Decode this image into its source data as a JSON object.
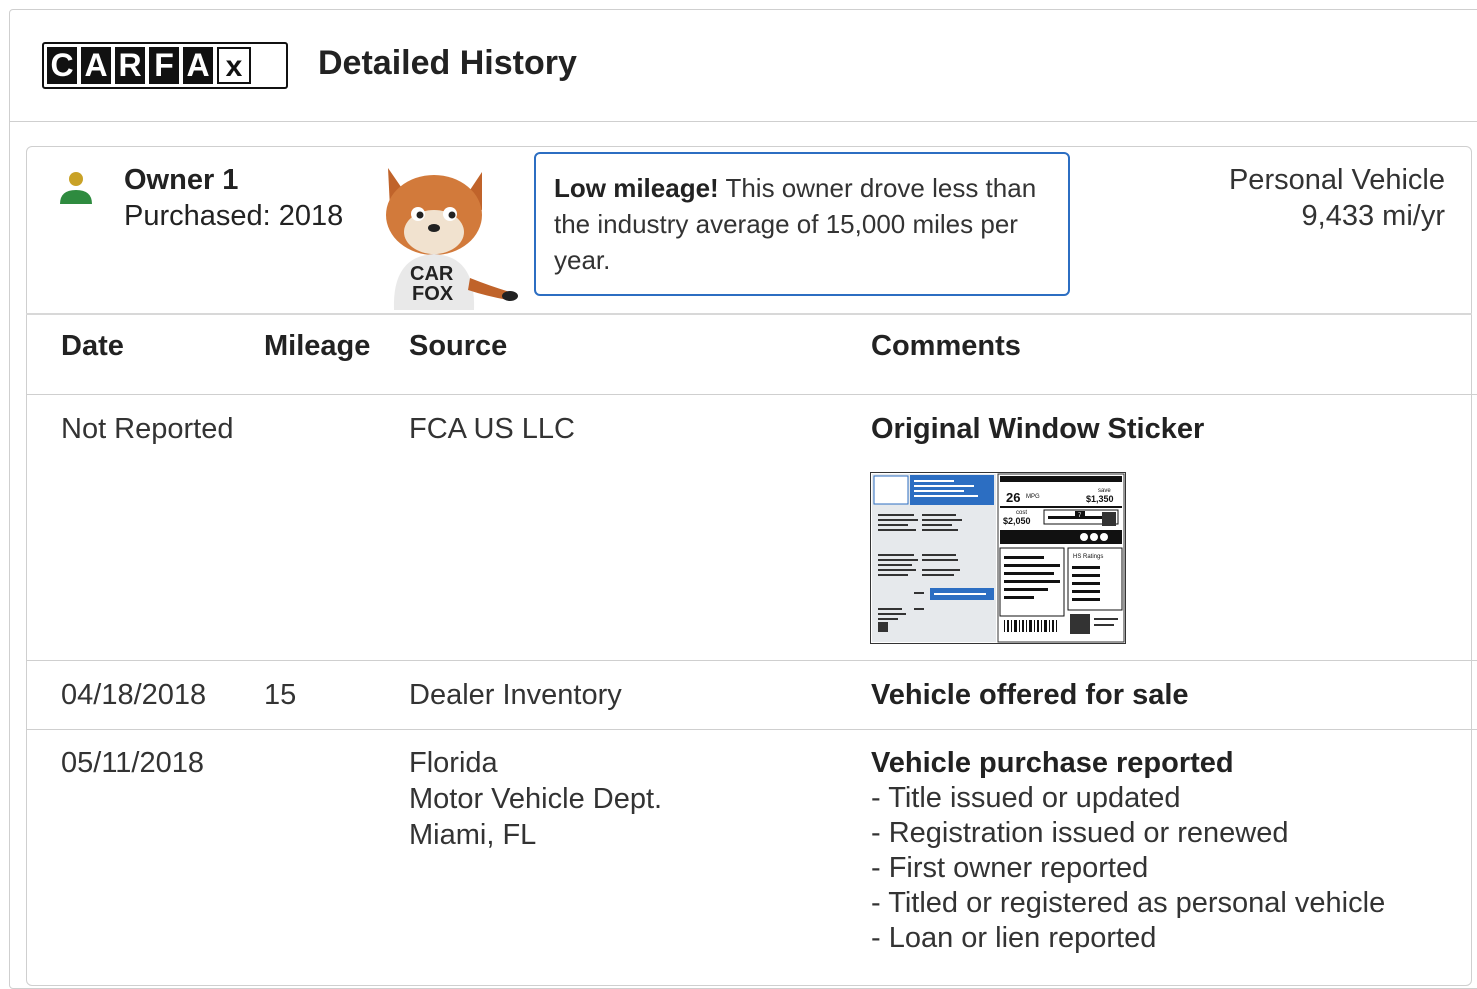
{
  "header": {
    "logo_letters": [
      "C",
      "A",
      "R",
      "F",
      "A",
      "x"
    ],
    "title": "Detailed History"
  },
  "owner": {
    "name": "Owner 1",
    "purchased": "Purchased: 2018",
    "icon": "person-icon",
    "icon_colors": {
      "head": "#c9a227",
      "body": "#2e8b3f"
    },
    "callout_bold": "Low mileage!",
    "callout_text": " This owner drove less than the industry average of 15,000 miles per year.",
    "usage_type": "Personal Vehicle",
    "usage_miles": "9,433 mi/yr"
  },
  "table": {
    "headers": {
      "date": "Date",
      "mileage": "Mileage",
      "source": "Source",
      "comments": "Comments"
    },
    "rows": [
      {
        "date": "Not Reported",
        "mileage": "",
        "source": [
          "FCA US LLC"
        ],
        "comment_title": "Original Window Sticker",
        "comment_items": []
      },
      {
        "date": "04/18/2018",
        "mileage": "15",
        "source": [
          "Dealer Inventory"
        ],
        "comment_title": "Vehicle offered for sale",
        "comment_items": []
      },
      {
        "date": "05/11/2018",
        "mileage": "",
        "source": [
          "Florida",
          "Motor Vehicle Dept.",
          "Miami, FL"
        ],
        "comment_title": "Vehicle purchase reported",
        "comment_items": [
          "- Title issued or updated",
          "- Registration issued or renewed",
          "- First owner reported",
          "- Titled or registered as personal vehicle",
          "- Loan or lien reported"
        ]
      }
    ]
  },
  "sticker": {
    "mpg": "26",
    "mpg_unit": "MPG",
    "save_label": "save",
    "save_amount": "$1,350",
    "cost_label": "cost",
    "cost_amount": "$2,050",
    "rating_label": "HS Ratings",
    "rating_value": "7"
  },
  "colors": {
    "accent": "#2c6ec2",
    "border": "#cfcfcf",
    "text": "#333333"
  }
}
